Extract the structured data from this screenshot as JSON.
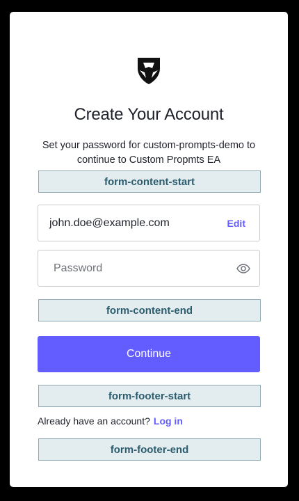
{
  "colors": {
    "brand": "#635dff",
    "text": "#1e212a",
    "marker_bg": "#e3ecef",
    "marker_text": "#2c5d6e"
  },
  "header": {
    "logo_icon": "shield-logo-icon",
    "title": "Create Your Account",
    "subtitle": "Set your password for custom-prompts-demo to continue to Custom Propmts EA"
  },
  "markers": {
    "form_content_start": "form-content-start",
    "form_content_end": "form-content-end",
    "form_footer_start": "form-footer-start",
    "form_footer_end": "form-footer-end"
  },
  "form": {
    "email_value": "john.doe@example.com",
    "edit_label": "Edit",
    "password_placeholder": "Password",
    "password_value": "",
    "eye_icon": "eye-icon",
    "continue_label": "Continue"
  },
  "footer": {
    "prompt_text": "Already have an account?",
    "login_label": "Log in"
  }
}
